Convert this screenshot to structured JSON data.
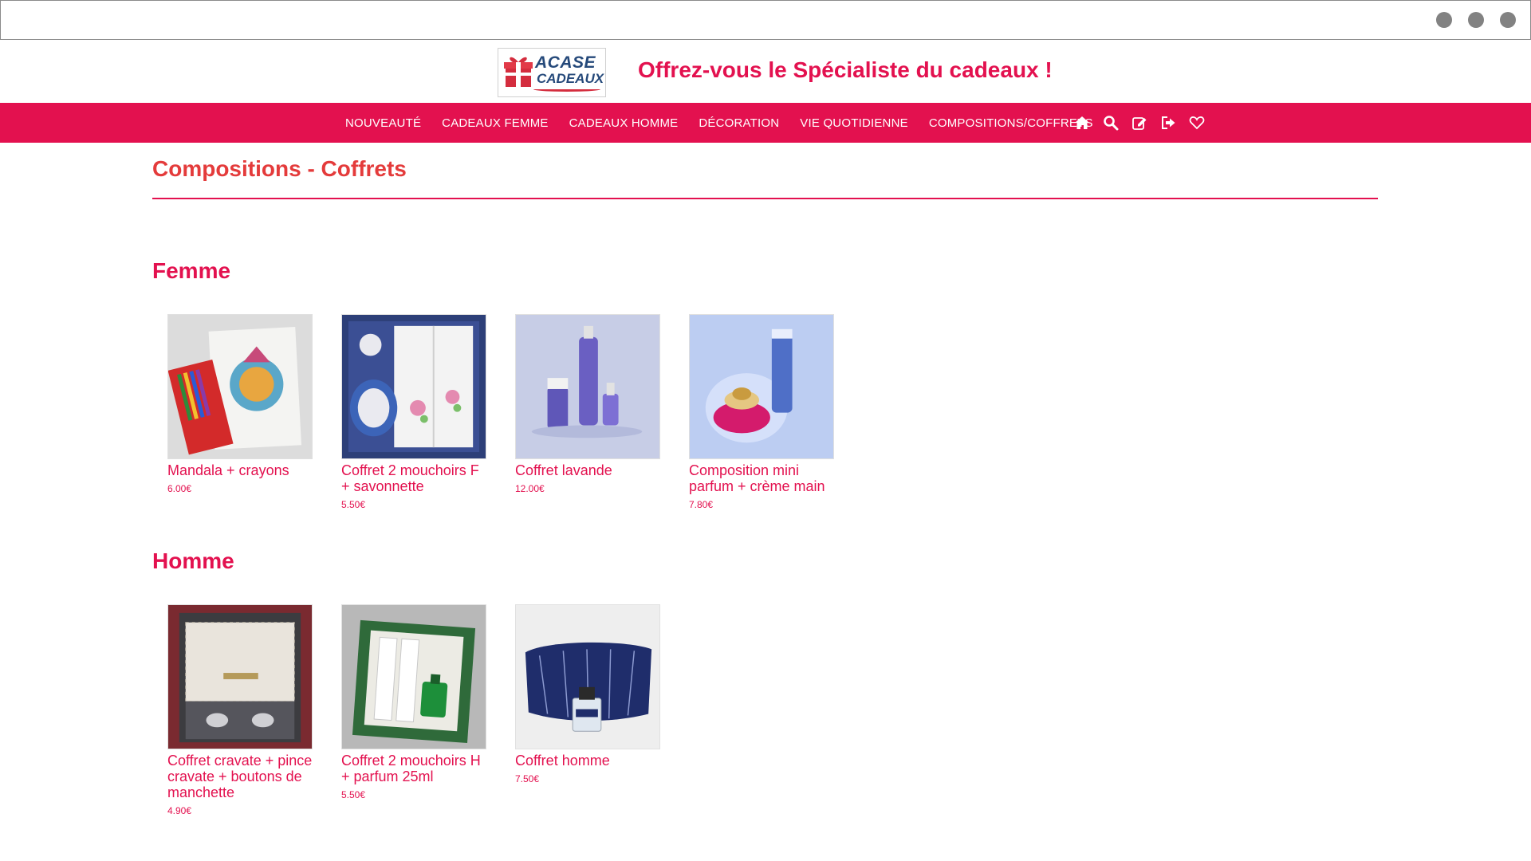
{
  "brand": {
    "logo_line1": "ACASE",
    "logo_line2": "CADEAUX",
    "tagline": "Offrez-vous le Spécialiste du cadeaux !"
  },
  "colors": {
    "accent": "#e3114f",
    "page_title": "#e43b3b"
  },
  "nav": {
    "items": [
      {
        "label": "NOUVEAUTÉ"
      },
      {
        "label": "CADEAUX FEMME"
      },
      {
        "label": "CADEAUX HOMME"
      },
      {
        "label": "DÉCORATION"
      },
      {
        "label": "VIE QUOTIDIENNE"
      },
      {
        "label": "COMPOSITIONS/COFFRETS"
      }
    ],
    "icons": [
      "home-icon",
      "search-icon",
      "edit-icon",
      "sign-out-icon",
      "heart-icon"
    ]
  },
  "page": {
    "title": "Compositions - Coffrets"
  },
  "sections": [
    {
      "title": "Femme",
      "products": [
        {
          "name": "Mandala + crayons",
          "price": "6.00€"
        },
        {
          "name": "Coffret 2 mouchoirs F + savonnette",
          "price": "5.50€"
        },
        {
          "name": "Coffret lavande",
          "price": "12.00€"
        },
        {
          "name": "Composition mini parfum + crème main",
          "price": "7.80€"
        }
      ]
    },
    {
      "title": "Homme",
      "products": [
        {
          "name": "Coffret cravate + pince cravate + boutons de manchette",
          "price": "4.90€"
        },
        {
          "name": "Coffret 2 mouchoirs H + parfum 25ml",
          "price": "5.50€"
        },
        {
          "name": "Coffret homme",
          "price": "7.50€"
        }
      ]
    }
  ]
}
